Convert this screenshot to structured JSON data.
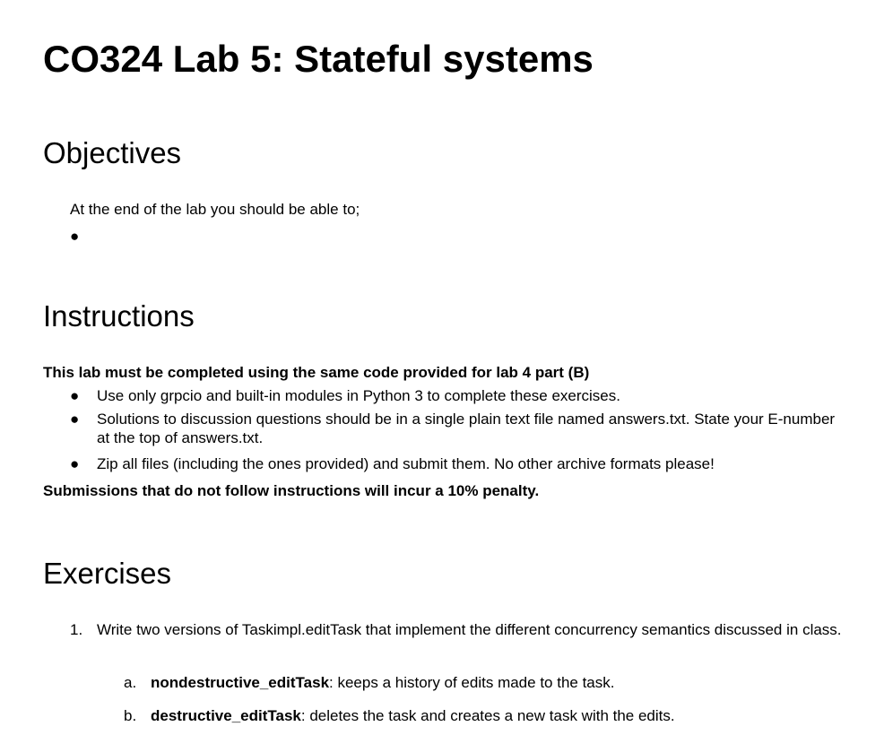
{
  "document": {
    "title": "CO324 Lab 5: Stateful systems",
    "objectives": {
      "heading": "Objectives",
      "intro": "At the end of the lab you should be able to;",
      "bullets": [
        ""
      ]
    },
    "instructions": {
      "heading": "Instructions",
      "lead": "This lab must be completed using the same code provided for lab 4 part (B)",
      "bullets": [
        "Use only grpcio and built-in modules in Python 3 to complete these exercises.",
        "Solutions to discussion questions should be in a single plain text file named answers.txt. State your E-number at the top of answers.txt.",
        "Zip all files (including the ones provided) and submit them. No other archive formats please!"
      ],
      "penalty": "Submissions that do not follow instructions will incur a 10% penalty."
    },
    "exercises": {
      "heading": "Exercises",
      "items": [
        {
          "marker": "1.",
          "text": "Write two versions of Taskimpl.editTask that implement the different concurrency semantics discussed in class.",
          "subitems": [
            {
              "marker": "a.",
              "keyword": "nondestructive_editTask",
              "text": ": keeps a history of edits made to the task."
            },
            {
              "marker": "b.",
              "keyword": "destructive_editTask",
              "text": ": deletes the task and creates a new task with the edits."
            }
          ]
        }
      ]
    }
  }
}
